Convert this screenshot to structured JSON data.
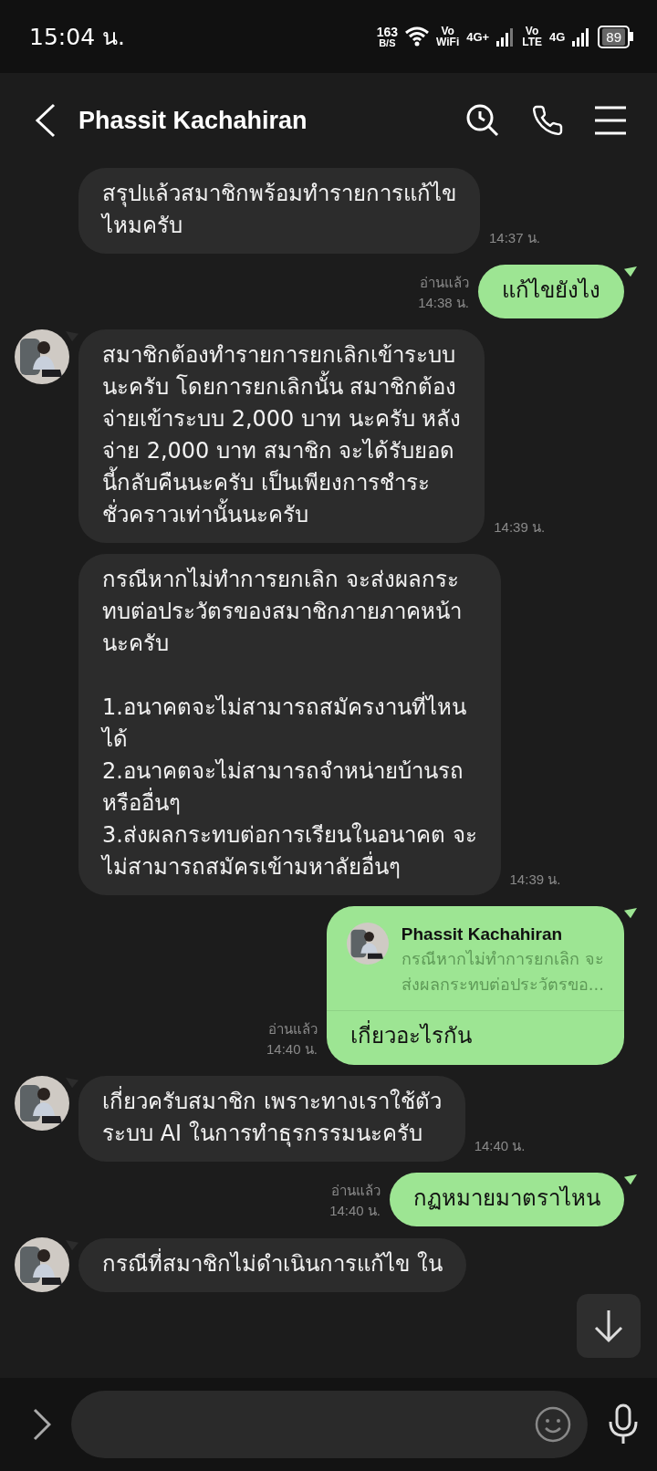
{
  "status_bar": {
    "time": "15:04 น.",
    "speed_value": "163",
    "speed_unit": "B/S",
    "wifi_calling": [
      "Vo",
      "WiFi"
    ],
    "network_1": "4G+",
    "volte": [
      "Vo",
      "LTE"
    ],
    "network_2": "4G",
    "battery": "89"
  },
  "header": {
    "title": "Phassit Kachahiran"
  },
  "messages": [
    {
      "kind": "received",
      "avatar": false,
      "text": "สรุปแล้วสมาชิกพร้อมทำรายการแก้ไข\nไหมครับ",
      "time": "14:37 น."
    },
    {
      "kind": "sent",
      "read": "อ่านแล้ว",
      "text": "แก้ไขยังไง",
      "time": "14:38 น."
    },
    {
      "kind": "received",
      "avatar": true,
      "text": "สมาชิกต้องทำรายการยกเลิกเข้าระบบ\nนะครับ โดยการยกเลิกนั้น สมาชิกต้อง\nจ่ายเข้าระบบ 2,000 บาท นะครับ หลัง\nจ่าย 2,000 บาท สมาชิก จะได้รับยอด\nนี้กลับคืนนะครับ เป็นเพียงการชำระ\nชั่วคราวเท่านั้นนะครับ",
      "time": "14:39 น."
    },
    {
      "kind": "received",
      "avatar": false,
      "text": "กรณีหากไม่ทำการยกเลิก จะส่งผลกระ\nทบต่อประวัตรของสมาชิกภายภาคหน้า\nนะครับ\n\n1.อนาคตจะไม่สามารถสมัครงานที่ไหน\nได้\n2.อนาคตจะไม่สามารถจำหน่ายบ้านรถ\nหรืออื่นๆ\n3.ส่งผลกระทบต่อการเรียนในอนาคต จะ\nไม่สามารถสมัครเข้ามหาลัยอื่นๆ",
      "time": "14:39 น."
    },
    {
      "kind": "sent",
      "read": "อ่านแล้ว",
      "quote": {
        "name": "Phassit Kachahiran",
        "text": "กรณีหากไม่ทำการยกเลิก จะ\nส่งผลกระทบต่อประวัตรขอ..."
      },
      "text": "เกี่ยวอะไรกัน",
      "time": "14:40 น."
    },
    {
      "kind": "received",
      "avatar": true,
      "text": "เกี่ยวครับสมาชิก เพราะทางเราใช้ตัว\nระบบ AI ในการทำธุรกรรมนะครับ",
      "time": "14:40 น."
    },
    {
      "kind": "sent",
      "read": "อ่านแล้ว",
      "text": "กฏหมายมาตราไหน",
      "time": "14:40 น."
    },
    {
      "kind": "received",
      "avatar": true,
      "text": "กรณีที่สมาชิกไม่ดำเนินการแก้ไข ใน"
    }
  ]
}
